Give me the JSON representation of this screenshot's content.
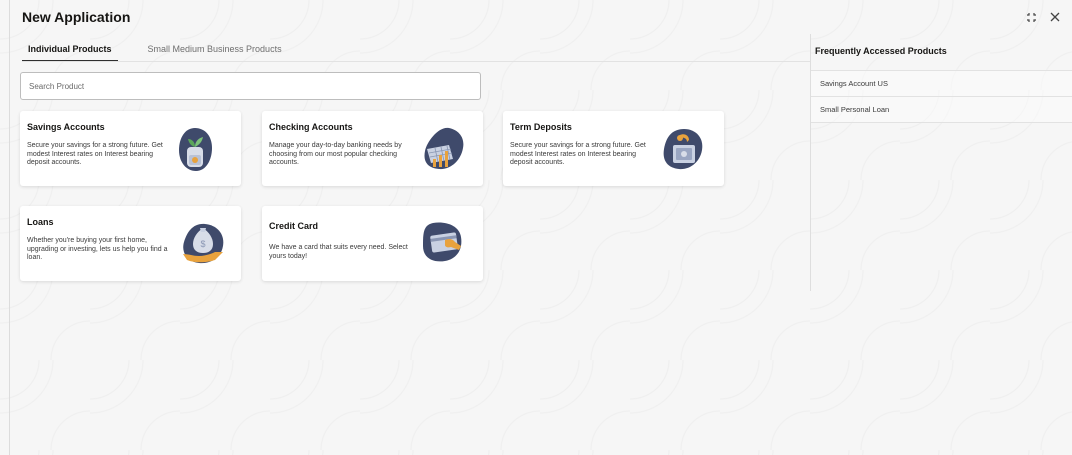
{
  "window": {
    "title": "New Application",
    "expand_icon": "expand-icon",
    "close_icon": "close-icon"
  },
  "tabs": [
    {
      "label": "Individual Products",
      "active": true
    },
    {
      "label": "Small Medium Business Products",
      "active": false
    }
  ],
  "search": {
    "placeholder": "Search Product",
    "value": ""
  },
  "products": [
    {
      "title": "Savings Accounts",
      "description": "Secure your savings for a strong future. Get modest Interest rates on Interest bearing deposit accounts.",
      "icon": "savings-jar-icon"
    },
    {
      "title": "Checking Accounts",
      "description": "Manage your day-to-day banking needs by choosing from our most popular checking accounts.",
      "icon": "calendar-chart-icon"
    },
    {
      "title": "Term Deposits",
      "description": "Secure your savings for a strong future. Get modest Interest rates on Interest bearing deposit accounts.",
      "icon": "safe-deposit-icon"
    },
    {
      "title": "Loans",
      "description": "Whether you're buying your first home, upgrading or investing, lets us help you find a loan.",
      "icon": "money-bag-hand-icon"
    },
    {
      "title": "Credit Card",
      "description": "We have a card that suits every need. Select yours today!",
      "icon": "credit-card-icon"
    }
  ],
  "frequently_accessed": {
    "title": "Frequently Accessed Products",
    "items": [
      "Savings Account US",
      "Small Personal Loan"
    ]
  },
  "colors": {
    "icon_dark": "#3f4a6b",
    "icon_accent": "#e8a23d",
    "card_bg": "#ffffff"
  }
}
